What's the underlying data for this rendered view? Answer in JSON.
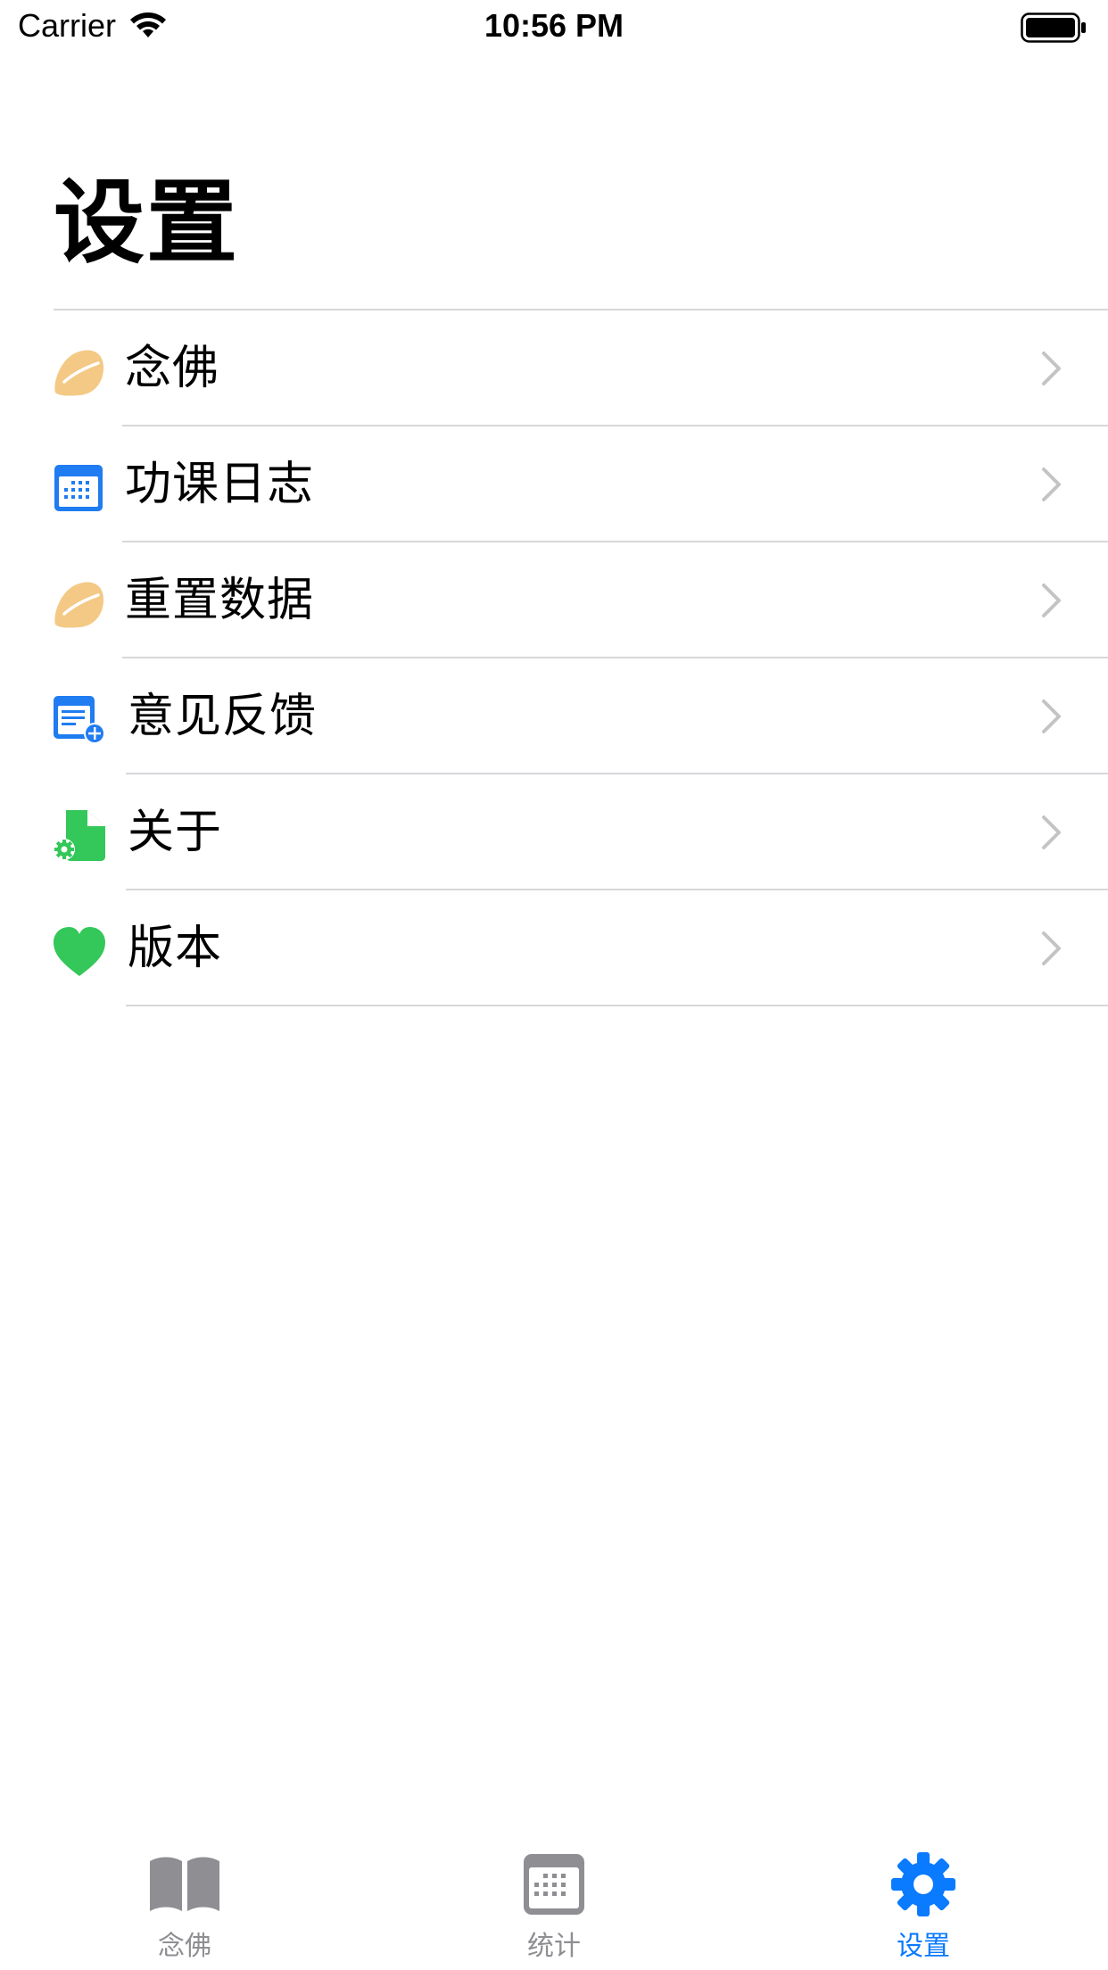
{
  "status_bar": {
    "carrier": "Carrier",
    "time": "10:56 PM"
  },
  "page": {
    "title": "设置"
  },
  "settings": {
    "items": [
      {
        "label": "念佛",
        "icon": "beads-icon"
      },
      {
        "label": "功课日志",
        "icon": "calendar-icon"
      },
      {
        "label": "重置数据",
        "icon": "beads-icon"
      },
      {
        "label": "意见反馈",
        "icon": "feedback-document-icon"
      },
      {
        "label": "关于",
        "icon": "document-gear-icon"
      },
      {
        "label": "版本",
        "icon": "heart-icon"
      }
    ]
  },
  "tab_bar": {
    "tabs": [
      {
        "label": "念佛",
        "icon": "book-icon",
        "selected": false
      },
      {
        "label": "统计",
        "icon": "calendar-icon",
        "selected": false
      },
      {
        "label": "设置",
        "icon": "gear-icon",
        "selected": true
      }
    ]
  },
  "colors": {
    "accent": "#0a7aff",
    "inactive": "#8e8e93",
    "chevron": "#c4c4c7",
    "divider": "#d7d7db",
    "beads": "#f3c985",
    "green": "#34c759",
    "blue_icon": "#1f7cf1"
  }
}
